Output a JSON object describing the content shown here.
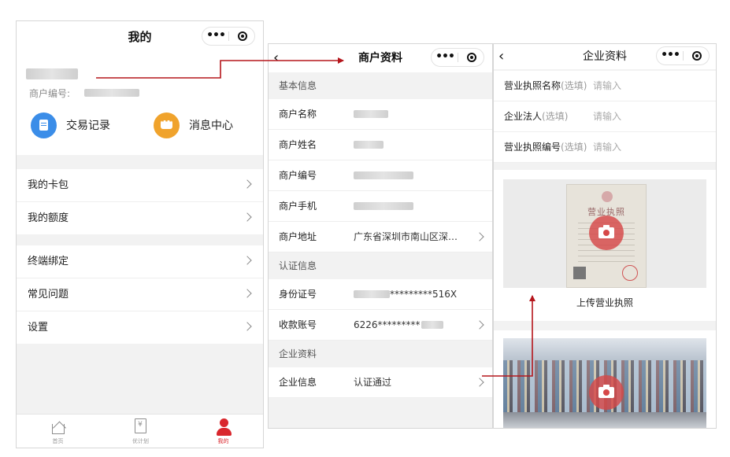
{
  "screen_mine": {
    "title": "我的",
    "merchant_no_label": "商户编号:",
    "quick_actions": [
      {
        "label": "交易记录",
        "icon": "document-icon",
        "color": "#3b8de8"
      },
      {
        "label": "消息中心",
        "icon": "chat-icon",
        "color": "#f0a32c"
      }
    ],
    "menu_group_1": [
      "我的卡包",
      "我的额度"
    ],
    "menu_group_2": [
      "终端绑定",
      "常见问题",
      "设置"
    ],
    "tabbar": [
      {
        "label": "首页",
        "icon": "home-icon"
      },
      {
        "label": "优计划",
        "icon": "bill-icon"
      },
      {
        "label": "我的",
        "icon": "person-icon",
        "active": true
      }
    ],
    "accent_color": "#d9262c"
  },
  "screen_merchant": {
    "title": "商户资料",
    "back_glyph": "‹",
    "sections": [
      {
        "label": "基本信息",
        "rows": [
          {
            "key": "商户名称",
            "value": ""
          },
          {
            "key": "商户姓名",
            "value": ""
          },
          {
            "key": "商户编号",
            "value": ""
          },
          {
            "key": "商户手机",
            "value": ""
          },
          {
            "key": "商户地址",
            "value": "广东省深圳市南山区深…"
          }
        ]
      },
      {
        "label": "认证信息",
        "rows": [
          {
            "key": "身份证号",
            "value": "*********516X"
          },
          {
            "key": "收款账号",
            "value": "6226*********"
          }
        ]
      },
      {
        "label": "企业资料",
        "rows": [
          {
            "key": "企业信息",
            "value": "认证通过"
          }
        ]
      }
    ]
  },
  "screen_company": {
    "title": "企业资料",
    "back_glyph": "‹",
    "fields": [
      {
        "label": "营业执照名称",
        "optional": "(选填)",
        "placeholder": "请输入"
      },
      {
        "label": "企业法人",
        "optional": "(选填)",
        "placeholder": "请输入"
      },
      {
        "label": "营业执照编号",
        "optional": "(选填)",
        "placeholder": "请输入"
      }
    ],
    "license_image_title": "营业执照",
    "upload_license_label": "上传营业执照"
  },
  "capsule": {
    "more_glyph": "•••"
  },
  "arrow_color": "#b5161c"
}
